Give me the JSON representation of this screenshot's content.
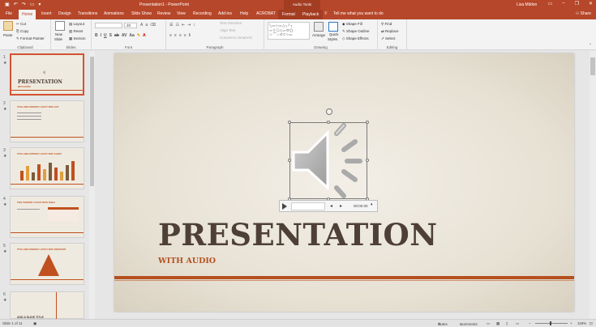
{
  "window": {
    "title": "Presentation1 - PowerPoint",
    "context_tab_group": "Audio Tools",
    "user": "Lisa Mildon"
  },
  "tabs": [
    "File",
    "Home",
    "Insert",
    "Design",
    "Transitions",
    "Animations",
    "Slide Show",
    "Review",
    "View",
    "Recording",
    "Add-ins",
    "Help",
    "ACROBAT",
    "Format",
    "Playback"
  ],
  "tell_me": "Tell me what you want to do",
  "share_label": "Share",
  "ribbon": {
    "clipboard": {
      "label": "Clipboard",
      "paste": "Paste",
      "cut": "Cut",
      "copy": "Copy",
      "format_painter": "Format Painter"
    },
    "slides": {
      "label": "Slides",
      "new_slide": "New",
      "new_slide2": "Slide",
      "layout": "Layout",
      "reset": "Reset",
      "section": "Section"
    },
    "font": {
      "label": "Font",
      "size": "20"
    },
    "paragraph": {
      "label": "Paragraph",
      "text_direction": "Text Direction",
      "align_text": "Align Text",
      "smartart": "Convert to SmartArt"
    },
    "drawing": {
      "label": "Drawing",
      "arrange": "Arrange",
      "quick_styles": "Quick",
      "quick_styles2": "Styles",
      "shape_fill": "Shape Fill",
      "shape_outline": "Shape Outline",
      "shape_effects": "Shape Effects"
    },
    "editing": {
      "label": "Editing",
      "find": "Find",
      "replace": "Replace",
      "select": "Select"
    }
  },
  "thumbnails": [
    {
      "num": "1",
      "title": "PRESENTATION",
      "sub": "WITH AUDIO"
    },
    {
      "num": "2",
      "title": "TITLE AND CONTENT LAYOUT WITH LIST"
    },
    {
      "num": "3",
      "title": "TITLE AND CONTENT LAYOUT WITH CHART"
    },
    {
      "num": "4",
      "title": "TWO CONTENT LAYOUT WITH TABLE"
    },
    {
      "num": "5",
      "title": "TITLE AND CONTENT LAYOUT WITH SMARTART"
    },
    {
      "num": "6",
      "title": "ADD A SLIDE TITLE"
    }
  ],
  "slide": {
    "title": "PRESENTATION",
    "subtitle": "WITH AUDIO",
    "audio_time": "00:00.00"
  },
  "status": {
    "slide_count": "Slide 1 of 11",
    "notes": "Notes",
    "comments": "Comments",
    "zoom": "118%"
  }
}
